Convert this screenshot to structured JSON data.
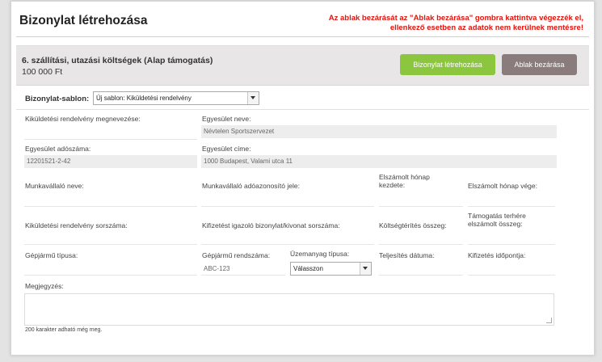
{
  "header": {
    "title": "Bizonylat létrehozása",
    "warning_line1": "Az ablak bezárását az \"Ablak bezárása\" gombra kattintva végezzék el,",
    "warning_line2": "ellenkező esetben az adatok nem kerülnek mentésre!"
  },
  "band": {
    "title": "6. szállítási, utazási költségek (Alap támogatás)",
    "amount": "100 000 Ft",
    "create_button": "Bizonylat létrehozása",
    "close_button": "Ablak bezárása"
  },
  "template": {
    "label": "Bizonylat-sablon:",
    "selected": "Új sablon: Kiküldetési rendelvény"
  },
  "fields": {
    "kikuldetesi_megnevezes": {
      "label": "Kiküldetési rendelvény megnevezése:"
    },
    "egyesulet_neve": {
      "label": "Egyesület neve:",
      "value": "Névtelen Sportszervezet"
    },
    "egyesulet_adoszama": {
      "label": "Egyesület adószáma:",
      "value": "12201521-2-42"
    },
    "egyesulet_cime": {
      "label": "Egyesület címe:",
      "value": "1000 Budapest, Valami utca 11"
    },
    "munkavallalo_neve": {
      "label": "Munkavállaló neve:"
    },
    "munkavallalo_adoazonosito": {
      "label": "Munkavállaló adóazonosító jele:"
    },
    "elszamolt_honap_kezdete": {
      "label_line1": "Elszámolt hónap",
      "label_line2": "kezdete:"
    },
    "elszamolt_honap_vege": {
      "label": "Elszámolt hónap vége:"
    },
    "kikuldetesi_sorszama": {
      "label": "Kiküldetési rendelvény sorszáma:"
    },
    "kifizetest_igazolo": {
      "label": "Kifizetést igazoló bizonylat/kivonat sorszáma:"
    },
    "koltsegterites_osszeg": {
      "label": "Költségtérítés összeg:"
    },
    "tamogatas_terhere": {
      "label_line1": "Támogatás terhére",
      "label_line2": "elszámolt összeg:"
    },
    "gepjarmu_tipusa": {
      "label": "Gépjármű típusa:"
    },
    "gepjarmu_rendszama": {
      "label": "Gépjármű rendszáma:",
      "value": "ABC-123"
    },
    "uzemanyag_tipusa": {
      "label": "Üzemanyag típusa:",
      "selected": "Válasszon"
    },
    "teljesites_datuma": {
      "label": "Teljesítés dátuma:"
    },
    "kifizetes_idopontja": {
      "label": "Kifizetés időpontja:"
    },
    "megjegyzes": {
      "label": "Megjegyzés:",
      "value": "",
      "remaining": "200 karakter adható még meg."
    }
  },
  "colors": {
    "accent_green": "#8cc63f",
    "button_gray": "#8a7c7c",
    "warning_red": "#e3120b",
    "band_background": "#e8e6e6"
  }
}
